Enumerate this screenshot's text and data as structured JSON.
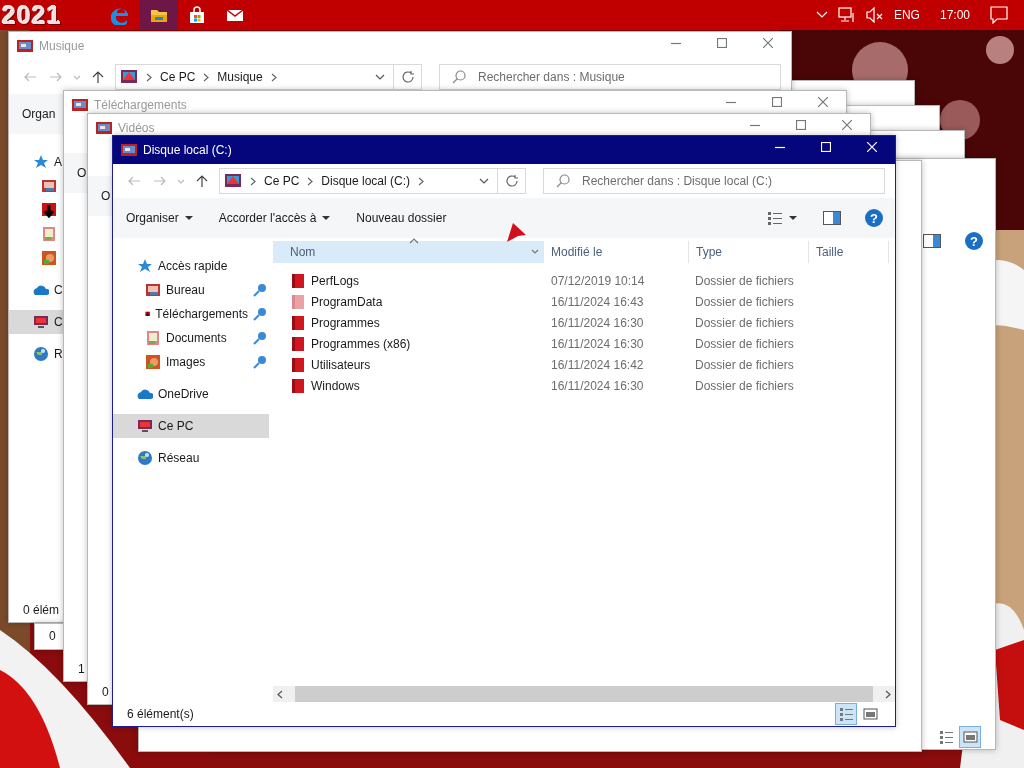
{
  "taskbar": {
    "logo": "2021",
    "apps": [
      {
        "kind": "browser",
        "active": false
      },
      {
        "kind": "explorer",
        "active": true
      },
      {
        "kind": "store",
        "active": false
      },
      {
        "kind": "mail",
        "active": false
      }
    ],
    "tray": {
      "language": "ENG",
      "time": "17:00"
    }
  },
  "windows": [
    {
      "kind": "explorer"
    },
    {
      "kind": "explorer"
    },
    {
      "kind": "explorer"
    },
    {
      "kind": "explorer",
      "preview_pane": true,
      "help_label": "?",
      "status_views": [
        {
          "kind": "details",
          "selected": false
        },
        {
          "kind": "tiles",
          "selected": true
        }
      ]
    },
    {
      "kind": "explorer"
    },
    {
      "kind": "explorer",
      "title": "Musique",
      "active": false,
      "nav_buttons": true,
      "crumbs": [
        "Ce PC",
        "Musique"
      ],
      "search_placeholder": "Rechercher dans : Musique",
      "toolbar": [
        {
          "label": "Organ",
          "menu": false
        }
      ],
      "nav": [
        {
          "label": "A",
          "kind": "quick-access",
          "selected": false,
          "children": [
            {
              "kind": "desktop",
              "selected": false
            },
            {
              "kind": "downloads",
              "selected": false
            },
            {
              "kind": "documents",
              "selected": false
            },
            {
              "kind": "pictures",
              "selected": false
            }
          ]
        },
        {
          "label": "C",
          "kind": "cloud",
          "selected": false
        },
        {
          "label": "C",
          "kind": "computer",
          "selected": true
        },
        {
          "label": "R",
          "kind": "network",
          "selected": false
        }
      ],
      "status": "0 élém"
    },
    {
      "kind": "explorer",
      "status": "0"
    },
    {
      "kind": "explorer",
      "title": "Téléchargements",
      "active": false,
      "toolbar": [
        {
          "label": "O",
          "menu": false
        }
      ],
      "status": "1"
    },
    {
      "kind": "explorer",
      "title": "Vidéos",
      "active": false,
      "toolbar": [
        {
          "label": "O",
          "menu": false
        }
      ],
      "status": "0"
    },
    {
      "kind": "explorer",
      "title": "Disque local (C:)",
      "active": true,
      "nav_buttons": true,
      "crumbs": [
        "Ce PC",
        "Disque local (C:)"
      ],
      "search_placeholder": "Rechercher dans : Disque local (C:)",
      "toolbar": [
        {
          "label": "Organiser",
          "menu": true
        },
        {
          "label": "Accorder l'accès à",
          "menu": true
        },
        {
          "label": "Nouveau dossier",
          "menu": false
        }
      ],
      "view_menu": true,
      "preview_pane": true,
      "help_label": "?",
      "nav": [
        {
          "label": "Accès rapide",
          "kind": "quick-access",
          "selected": false,
          "children": [
            {
              "label": "Bureau",
              "kind": "desktop",
              "pinned": true,
              "selected": false
            },
            {
              "label": "Téléchargements",
              "kind": "downloads",
              "pinned": true,
              "selected": false
            },
            {
              "label": "Documents",
              "kind": "documents",
              "pinned": true,
              "selected": false
            },
            {
              "label": "Images",
              "kind": "pictures",
              "pinned": true,
              "selected": false
            }
          ]
        },
        {
          "label": "OneDrive",
          "kind": "cloud",
          "selected": false
        },
        {
          "label": "Ce PC",
          "kind": "computer",
          "selected": true
        },
        {
          "label": "Réseau",
          "kind": "network",
          "selected": false
        }
      ],
      "columns": [
        {
          "label": "Nom",
          "sorted": true
        },
        {
          "label": "Modifié le",
          "sorted": false
        },
        {
          "label": "Type",
          "sorted": false
        },
        {
          "label": "Taille",
          "sorted": false
        }
      ],
      "rows": [
        {
          "name": "PerfLogs",
          "modified": "07/12/2019 10:14",
          "type": "Dossier de fichiers",
          "hidden": false
        },
        {
          "name": "ProgramData",
          "modified": "16/11/2024 16:43",
          "type": "Dossier de fichiers",
          "hidden": true
        },
        {
          "name": "Programmes",
          "modified": "16/11/2024 16:30",
          "type": "Dossier de fichiers",
          "hidden": false
        },
        {
          "name": "Programmes (x86)",
          "modified": "16/11/2024 16:30",
          "type": "Dossier de fichiers",
          "hidden": false
        },
        {
          "name": "Utilisateurs",
          "modified": "16/11/2024 16:42",
          "type": "Dossier de fichiers",
          "hidden": false
        },
        {
          "name": "Windows",
          "modified": "16/11/2024 16:30",
          "type": "Dossier de fichiers",
          "hidden": false
        }
      ],
      "hscroll": true,
      "status": "6 élément(s)",
      "status_views": [
        {
          "kind": "details",
          "selected": true
        },
        {
          "kind": "tiles",
          "selected": false
        }
      ]
    }
  ],
  "pointer": {
    "kind": "arrow"
  }
}
